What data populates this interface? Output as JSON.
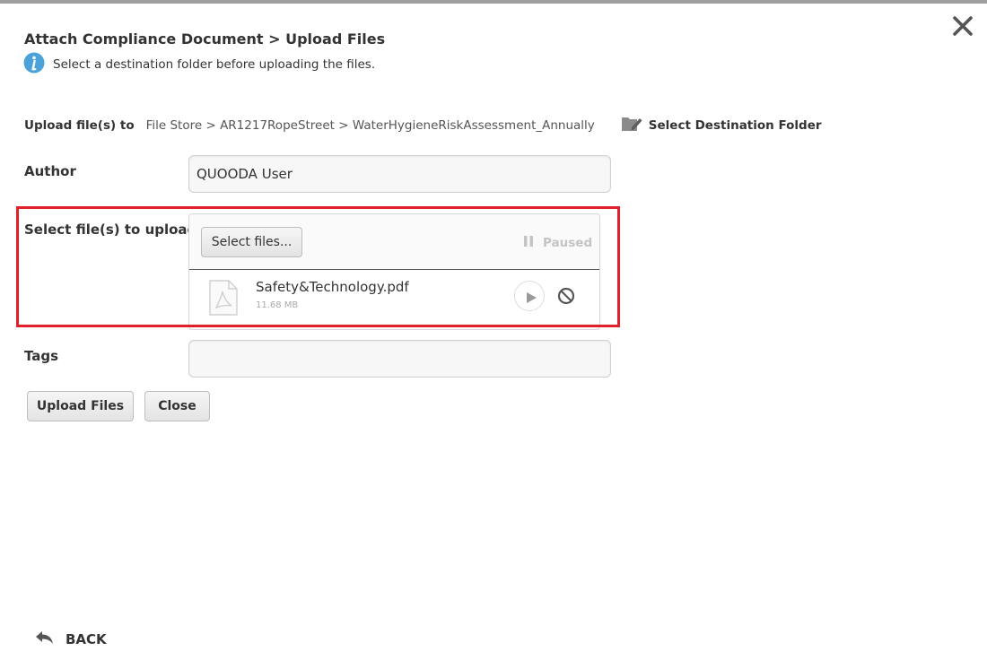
{
  "header": {
    "title": "Attach Compliance Document > Upload Files",
    "info_message": "Select a destination folder before uploading the files."
  },
  "destination": {
    "label": "Upload file(s) to",
    "path": "File Store > AR1217RopeStreet > WaterHygieneRiskAssessment_Annually",
    "select_label": "Select Destination Folder"
  },
  "form": {
    "author_label": "Author",
    "author_value": "QUOODA User",
    "files_label": "Select file(s) to upload",
    "tags_label": "Tags",
    "tags_value": ""
  },
  "uploader": {
    "select_button": "Select files...",
    "status": "Paused",
    "files": [
      {
        "name": "Safety&Technology.pdf",
        "size": "11.68 MB"
      }
    ]
  },
  "actions": {
    "upload_label": "Upload Files",
    "close_label": "Close"
  },
  "footer": {
    "back_label": "BACK"
  },
  "icons": {
    "close": "close-icon",
    "info": "info-icon",
    "folder": "folder-icon",
    "pause": "pause-icon",
    "pdf": "pdf-file-icon",
    "play": "play-icon",
    "cancel": "cancel-icon",
    "back": "back-arrow-icon"
  },
  "colors": {
    "info_blue": "#4aa3d8",
    "highlight_red": "#e0202a",
    "status_gray": "#c4c4c4"
  }
}
